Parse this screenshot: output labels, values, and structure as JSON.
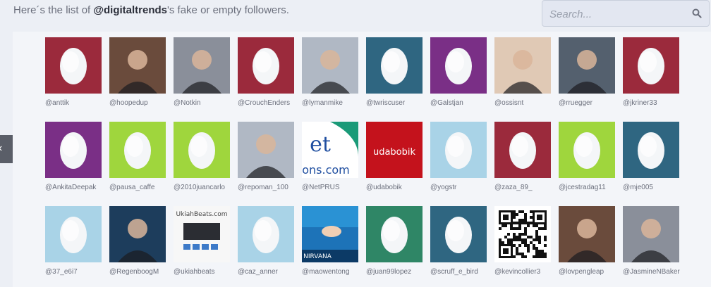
{
  "header": {
    "prefix": "Here´s the list of ",
    "handle": "@digitaltrends",
    "suffix": "'s fake or empty followers."
  },
  "search": {
    "placeholder": "Search...",
    "icon": "search-icon"
  },
  "colors": {
    "page_bg": "#eceff5",
    "maroon": "#9b2a3c",
    "teal": "#2f6681",
    "purple": "#7a2f86",
    "lime": "#9fd63d",
    "lightblue": "#a9d3e7",
    "green": "#2f8666"
  },
  "followers": [
    {
      "handle": "@anttik",
      "avatar": "egg-maroon"
    },
    {
      "handle": "@hoopedup",
      "avatar": "photo"
    },
    {
      "handle": "@Notkin",
      "avatar": "photo"
    },
    {
      "handle": "@CrouchEnders",
      "avatar": "egg-maroon"
    },
    {
      "handle": "@lymanmike",
      "avatar": "photo"
    },
    {
      "handle": "@twriscuser",
      "avatar": "egg-teal"
    },
    {
      "handle": "@Galstjan",
      "avatar": "egg-purple"
    },
    {
      "handle": "@ossisnt",
      "avatar": "photo"
    },
    {
      "handle": "@rruegger",
      "avatar": "photo"
    },
    {
      "handle": "@jkriner33",
      "avatar": "egg-maroon"
    },
    {
      "handle": "@AnkitaDeepak",
      "avatar": "egg-purple"
    },
    {
      "handle": "@pausa_caffe",
      "avatar": "egg-lime"
    },
    {
      "handle": "@2010juancarlo",
      "avatar": "egg-lime"
    },
    {
      "handle": "@repoman_100",
      "avatar": "photo"
    },
    {
      "handle": "@NetPRUS",
      "avatar": "photo",
      "text": "et",
      "subtext": "ons.com"
    },
    {
      "handle": "@udabobik",
      "avatar": "photo",
      "text": "udabobik"
    },
    {
      "handle": "@yogstr",
      "avatar": "egg-lightblue"
    },
    {
      "handle": "@zaza_89_",
      "avatar": "egg-maroon"
    },
    {
      "handle": "@jcestradag11",
      "avatar": "egg-lime"
    },
    {
      "handle": "@mje005",
      "avatar": "egg-teal"
    },
    {
      "handle": "@37_e6i7",
      "avatar": "egg-lightblue"
    },
    {
      "handle": "@RegenboogM",
      "avatar": "photo"
    },
    {
      "handle": "@ukiahbeats",
      "avatar": "photo",
      "text": "UkiahBeats.com"
    },
    {
      "handle": "@caz_anner",
      "avatar": "egg-lightblue"
    },
    {
      "handle": "@maowentong",
      "avatar": "photo",
      "text": "NIRVANA"
    },
    {
      "handle": "@juan99lopez",
      "avatar": "egg-green"
    },
    {
      "handle": "@scruff_e_bird",
      "avatar": "egg-teal"
    },
    {
      "handle": "@kevincollier3",
      "avatar": "qr-code"
    },
    {
      "handle": "@lovpengleap",
      "avatar": "photo"
    },
    {
      "handle": "@JasmineNBaker",
      "avatar": "photo"
    }
  ]
}
